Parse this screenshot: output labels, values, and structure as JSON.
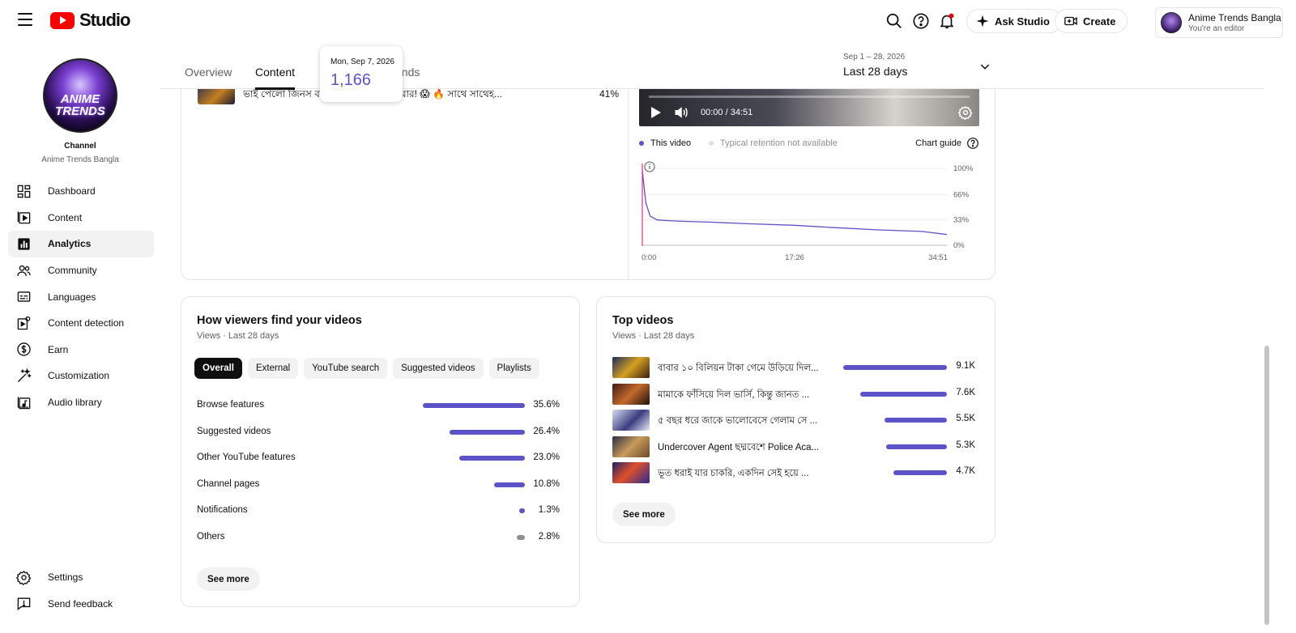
{
  "header": {
    "logo_text": "Studio",
    "ask_studio": "Ask Studio",
    "create": "Create",
    "account_name": "Anime Trends Bangla",
    "account_role": "You're an editor"
  },
  "sidebar": {
    "avatar_line1": "ANIME",
    "avatar_line2": "TRENDS",
    "channel_label": "Channel",
    "channel_name": "Anime Trends Bangla",
    "items": [
      {
        "label": "Dashboard",
        "icon": "dashboard-icon"
      },
      {
        "label": "Content",
        "icon": "content-icon"
      },
      {
        "label": "Analytics",
        "icon": "analytics-icon",
        "active": true
      },
      {
        "label": "Community",
        "icon": "community-icon"
      },
      {
        "label": "Languages",
        "icon": "languages-icon"
      },
      {
        "label": "Content detection",
        "icon": "content-detection-icon"
      },
      {
        "label": "Earn",
        "icon": "earn-icon"
      },
      {
        "label": "Customization",
        "icon": "customization-icon"
      },
      {
        "label": "Audio library",
        "icon": "audio-library-icon"
      }
    ],
    "bottom_items": [
      {
        "label": "Settings",
        "icon": "settings-icon"
      },
      {
        "label": "Send feedback",
        "icon": "feedback-icon"
      }
    ]
  },
  "tabs": [
    {
      "label": "Overview"
    },
    {
      "label": "Content",
      "active": true
    },
    {
      "label": "ends"
    }
  ],
  "date_range": {
    "small": "Sep 1 – 28, 2026",
    "main": "Last 28 days"
  },
  "tooltip": {
    "date": "Mon, Sep 7, 2026",
    "value": "1,166"
  },
  "top_card": {
    "prev_video_title": "ভাই পেলো জিনস ব                     আমি পেলাম ছোট করার! 😱 🔥 সাথে সাথেহ...",
    "prev_video_pct": "41%",
    "player_time": "00:00 / 34:51",
    "legend_this": "This video",
    "legend_typical": "Typical retention not available",
    "chart_guide": "Chart guide"
  },
  "chart_data": {
    "type": "line",
    "title": "",
    "xlabel": "",
    "ylabel": "",
    "x_ticks": [
      "0:00",
      "17:26",
      "34:51"
    ],
    "y_ticks": [
      "100%",
      "66%",
      "33%",
      "0%"
    ],
    "ylim": [
      0,
      100
    ],
    "series": [
      {
        "name": "This video",
        "color": "#5b53c7",
        "x_minutes": [
          0,
          0.4,
          0.9,
          1.7,
          3,
          5,
          8,
          12,
          17.4,
          22,
          27,
          32,
          34.85
        ],
        "values": [
          97,
          55,
          38,
          33,
          32,
          31,
          30,
          28,
          26,
          23,
          20,
          18,
          14
        ]
      }
    ]
  },
  "traffic": {
    "title": "How viewers find your videos",
    "subtitle": "Views · Last 28 days",
    "chips": [
      {
        "label": "Overall",
        "active": true
      },
      {
        "label": "External"
      },
      {
        "label": "YouTube search"
      },
      {
        "label": "Suggested videos"
      },
      {
        "label": "Playlists"
      }
    ],
    "rows": [
      {
        "label": "Browse features",
        "pct_text": "35.6%",
        "value": 35.6
      },
      {
        "label": "Suggested videos",
        "pct_text": "26.4%",
        "value": 26.4
      },
      {
        "label": "Other YouTube features",
        "pct_text": "23.0%",
        "value": 23.0
      },
      {
        "label": "Channel pages",
        "pct_text": "10.8%",
        "value": 10.8
      },
      {
        "label": "Notifications",
        "pct_text": "1.3%",
        "value": 1.3
      },
      {
        "label": "Others",
        "pct_text": "2.8%",
        "value": 2.8,
        "color": "#909090"
      }
    ],
    "see_more": "See more"
  },
  "top_videos": {
    "title": "Top videos",
    "subtitle": "Views · Last 28 days",
    "rows": [
      {
        "title": "বাবার ১০ বিলিয়ন টাকা গেমে উড়িয়ে দিল...",
        "views_text": "9.1K",
        "value": 9.1
      },
      {
        "title": "মামাকে ফাঁসিয়ে দিল ভার্সি, কিন্তু জানত ...",
        "views_text": "7.6K",
        "value": 7.6
      },
      {
        "title": "৫ বছর ধরে জাকে ভালোবেসে গেলাম সে ...",
        "views_text": "5.5K",
        "value": 5.5
      },
      {
        "title": "Undercover Agent ছদ্মবেশে Police Aca...",
        "views_text": "5.3K",
        "value": 5.3
      },
      {
        "title": "ভূত ধরাই যার চাকরি, একদিন সেই হয়ে ...",
        "views_text": "4.7K",
        "value": 4.7
      }
    ],
    "see_more": "See more"
  }
}
